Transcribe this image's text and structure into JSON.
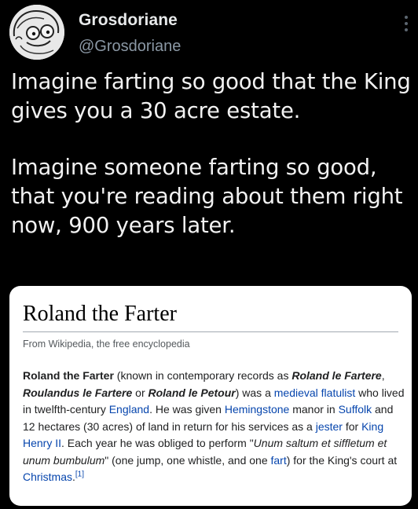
{
  "tweet": {
    "display_name": "Grosdoriane",
    "handle": "@Grosdoriane",
    "more_icon": "vertical-ellipsis-icon",
    "paragraph_1": "Imagine farting so good that the King gives you a 30 acre estate.",
    "paragraph_2": "Imagine someone farting so good, that you're reading about them right now, 900 years later."
  },
  "card": {
    "title": "Roland the Farter",
    "subtitle": "From Wikipedia, the free encyclopedia",
    "body": {
      "name_bold": "Roland the Farter",
      "t1": " (known in contemporary records as ",
      "alias1": "Roland le Fartere",
      "t2": ", ",
      "alias2": "Roulandus le Fartere",
      "t3": " or ",
      "alias3": "Roland le Petour",
      "t4": ") was a ",
      "link_medieval": "medieval",
      "t5": " ",
      "link_flatulist": "flatulist",
      "t6": " who lived in twelfth-century ",
      "link_england": "England",
      "t7": ". He was given ",
      "link_hemingstone": "Hemingstone",
      "t8": " manor in ",
      "link_suffolk": "Suffolk",
      "t9": " and 12 hectares (30 acres) of land in return for his services as a ",
      "link_jester": "jester",
      "t10": " for ",
      "link_king": "King Henry II",
      "t11": ". Each year he was obliged to perform \"",
      "latin": "Unum saltum et siffletum et unum bumbulum",
      "t12": "\" (one jump, one whistle, and one ",
      "link_fart": "fart",
      "t13": ") for the King's court at ",
      "link_christmas": "Christmas",
      "t14": ".",
      "ref": "[1]"
    }
  },
  "colors": {
    "background": "#000000",
    "handle": "#8b98a5",
    "wiki_link": "#0645ad"
  }
}
